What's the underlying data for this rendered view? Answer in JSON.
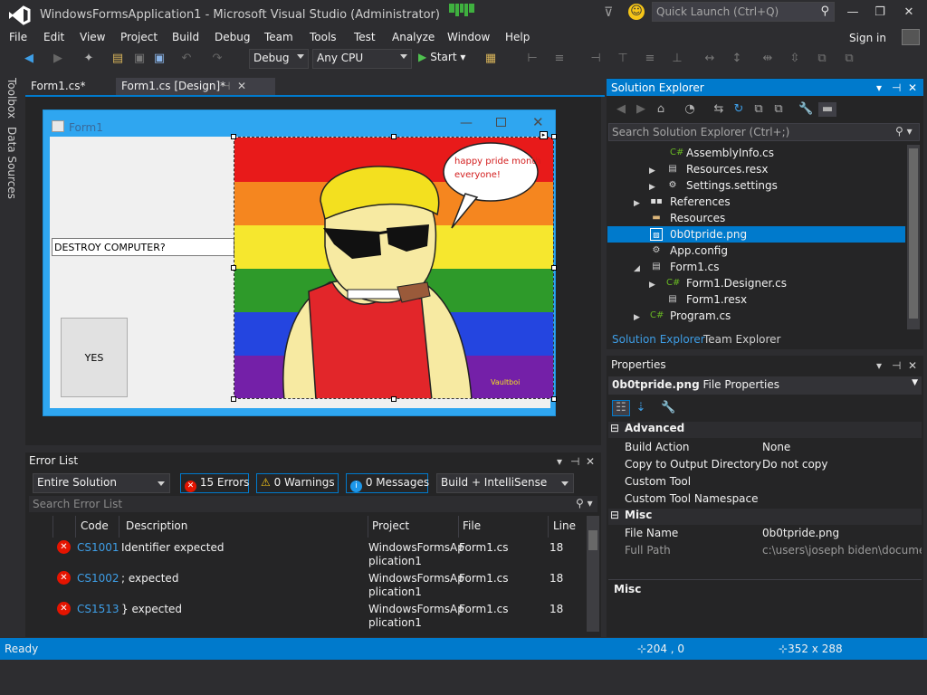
{
  "window": {
    "title": "WindowsFormsApplication1 - Microsoft Visual Studio (Administrator)",
    "quick_launch_placeholder": "Quick Launch (Ctrl+Q)",
    "accent": "#007acc"
  },
  "menu": {
    "items": [
      "File",
      "Edit",
      "View",
      "Project",
      "Build",
      "Debug",
      "Team",
      "Tools",
      "Test",
      "Analyze",
      "Window",
      "Help"
    ],
    "sign_in": "Sign in"
  },
  "toolbar": {
    "config": "Debug",
    "platform": "Any CPU",
    "start": "Start"
  },
  "left_rail": {
    "tabs": [
      "Toolbox",
      "Data Sources"
    ]
  },
  "document_tabs": [
    {
      "label": "Form1.cs*"
    },
    {
      "label": "Form1.cs [Design]*"
    }
  ],
  "designer": {
    "form_title": "Form1",
    "textbox_value": "DESTROY COMPUTER?",
    "button_label": "YES",
    "speech_bubble": [
      "happy pride month",
      "everyone!"
    ],
    "signature": "Vaultboi"
  },
  "error_list": {
    "title": "Error List",
    "scope": "Entire Solution",
    "errors_filter": "15 Errors",
    "warnings_filter": "0 Warnings",
    "messages_filter": "0 Messages",
    "source": "Build + IntelliSense",
    "search_placeholder": "Search Error List",
    "columns": [
      "Code",
      "Description",
      "Project",
      "File",
      "Line"
    ],
    "rows": [
      {
        "code": "CS1001",
        "description": "Identifier expected",
        "project": [
          "WindowsFormsAp",
          "plication1"
        ],
        "file": "Form1.cs",
        "line": "18"
      },
      {
        "code": "CS1002",
        "description": "; expected",
        "project": [
          "WindowsFormsAp",
          "plication1"
        ],
        "file": "Form1.cs",
        "line": "18"
      },
      {
        "code": "CS1513",
        "description": "} expected",
        "project": [
          "WindowsFormsAp",
          "plication1"
        ],
        "file": "Form1.cs",
        "line": "18"
      }
    ]
  },
  "solution_explorer": {
    "title": "Solution Explorer",
    "search_placeholder": "Search Solution Explorer (Ctrl+;)",
    "tree": [
      {
        "label": "AssemblyInfo.cs",
        "icon": "csharp-file-icon"
      },
      {
        "label": "Resources.resx",
        "icon": "resx-file-icon"
      },
      {
        "label": "Settings.settings",
        "icon": "settings-icon"
      },
      {
        "label": "References",
        "icon": "references-icon"
      },
      {
        "label": "Resources",
        "icon": "folder-icon"
      },
      {
        "label": "0b0tpride.png",
        "icon": "image-file-icon"
      },
      {
        "label": "App.config",
        "icon": "config-file-icon"
      },
      {
        "label": "Form1.cs",
        "icon": "form-file-icon"
      },
      {
        "label": "Form1.Designer.cs",
        "icon": "csharp-file-icon"
      },
      {
        "label": "Form1.resx",
        "icon": "resx-file-icon"
      },
      {
        "label": "Program.cs",
        "icon": "csharp-file-icon"
      }
    ],
    "tabs": [
      "Solution Explorer",
      "Team Explorer"
    ]
  },
  "properties": {
    "title": "Properties",
    "object_name": "0b0tpride.png",
    "object_type": "File Properties",
    "categories": [
      {
        "name": "Advanced",
        "props": [
          {
            "name": "Build Action",
            "value": "None"
          },
          {
            "name": "Copy to Output Directory",
            "value": "Do not copy"
          },
          {
            "name": "Custom Tool",
            "value": ""
          },
          {
            "name": "Custom Tool Namespace",
            "value": ""
          }
        ]
      },
      {
        "name": "Misc",
        "props": [
          {
            "name": "File Name",
            "value": "0b0tpride.png"
          },
          {
            "name": "Full Path",
            "value": "c:\\users\\joseph biden\\document"
          }
        ]
      }
    ],
    "description_title": "Misc"
  },
  "status": {
    "text": "Ready",
    "position": "204 , 0",
    "size": "352 x 288"
  }
}
